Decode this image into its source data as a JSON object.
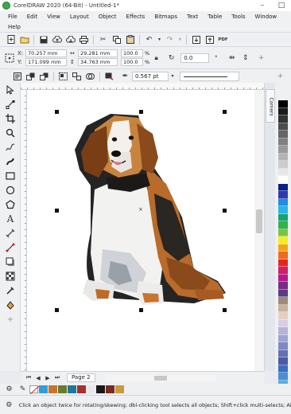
{
  "app": {
    "title": "CorelDRAW 2020 (64-Bit) - Untitled-1*"
  },
  "window_controls": {
    "minimize": "–",
    "maximize": "□"
  },
  "menu": {
    "row1": [
      "File",
      "Edit",
      "View",
      "Layout",
      "Object",
      "Effects",
      "Bitmaps",
      "Text",
      "Table",
      "Tools",
      "Window"
    ],
    "row2": [
      "Help"
    ]
  },
  "property_bar": {
    "x_label": "X:",
    "x_value": "70.257 mm",
    "y_label": "Y:",
    "y_value": "171.099 mm",
    "width_value": "29.281 mm",
    "height_value": "34.763 mm",
    "scale_x": "100.0",
    "scale_y": "100.0",
    "pct_symbol": "%",
    "rotation_value": "0.0"
  },
  "outline": {
    "width_value": "0.567 pt"
  },
  "standard_toolbar": {
    "pdf_label": "PDF"
  },
  "docker": {
    "tab_label": "Corners"
  },
  "page_tabs": {
    "current": "Page 2"
  },
  "colors": {
    "palette": [
      "#000000",
      "#1a1a1a",
      "#333333",
      "#4d4d4d",
      "#666666",
      "#808080",
      "#999999",
      "#b3b3b3",
      "#cccccc",
      "#e6e6e6",
      "#ffffff",
      "#0b1f8c",
      "#2d3bb0",
      "#1c8ee6",
      "#29b4e8",
      "#1aa36b",
      "#2fb34a",
      "#7cc242",
      "#f7ec1f",
      "#f6a21a",
      "#ef6a23",
      "#e52421",
      "#d01f6b",
      "#b5198c",
      "#7b2a86",
      "#5a3b7d",
      "#9e8a7a",
      "#c9b29b",
      "#e6cfc2",
      "#d8cde6",
      "#b8b2d9",
      "#9ea3cf",
      "#8088c2",
      "#6670b3",
      "#4d5aa3",
      "#3b6cc2",
      "#4a8fd4",
      "#5aaee0"
    ],
    "document_palette": [
      "#2e9fd9",
      "#c7752a",
      "#6a7a2e",
      "#1e7a9c",
      "#a5322e",
      "#e9e9e9",
      "#181818",
      "#7a2a1e",
      "#c89a3e",
      "#f0f0f0"
    ]
  },
  "status": {
    "message": "Click an object twice for rotating/skewing; dbl-clicking tool selects all objects; Shift+click multi-selects; Alt+click d"
  }
}
